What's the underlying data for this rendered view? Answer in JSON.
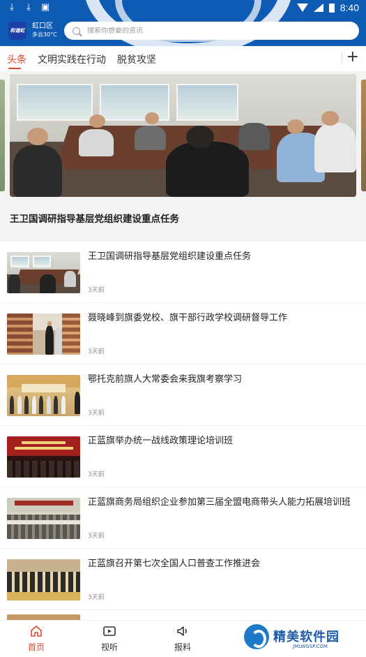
{
  "status_bar": {
    "time": "8:40"
  },
  "header": {
    "logo_text": "和谐虹",
    "location": "虹口区",
    "weather": "多云30°C",
    "search_placeholder": "搜索你想要的资讯"
  },
  "tabs": [
    {
      "label": "头条",
      "active": true
    },
    {
      "label": "文明实践在行动",
      "active": false
    },
    {
      "label": "脱贫攻坚",
      "active": false
    }
  ],
  "featured": {
    "title": "王卫国调研指导基层党组织建设重点任务"
  },
  "news": [
    {
      "title": "王卫国调研指导基层党组织建设重点任务",
      "time": "3天前"
    },
    {
      "title": "聂晓峰到旗委党校、旗干部行政学校调研督导工作",
      "time": "3天前"
    },
    {
      "title": "鄂托克前旗人大常委会来我旗考察学习",
      "time": "3天前"
    },
    {
      "title": "正蓝旗举办统一战线政策理论培训班",
      "time": "3天前"
    },
    {
      "title": "正蓝旗商务局组织企业参加第三届全盟电商带头人能力拓展培训班",
      "time": "3天前"
    },
    {
      "title": "正蓝旗召开第七次全国人口普查工作推进会",
      "time": "3天前"
    }
  ],
  "bottom_nav": [
    {
      "label": "首页",
      "icon": "home-icon",
      "active": true
    },
    {
      "label": "视听",
      "icon": "video-icon",
      "active": false
    },
    {
      "label": "报料",
      "icon": "speaker-icon",
      "active": false
    }
  ],
  "watermark": {
    "name": "精美软件园",
    "url": "JMLWGSP.COM"
  },
  "colors": {
    "brand_blue": "#0d5bb3",
    "accent_red": "#e0442a"
  }
}
